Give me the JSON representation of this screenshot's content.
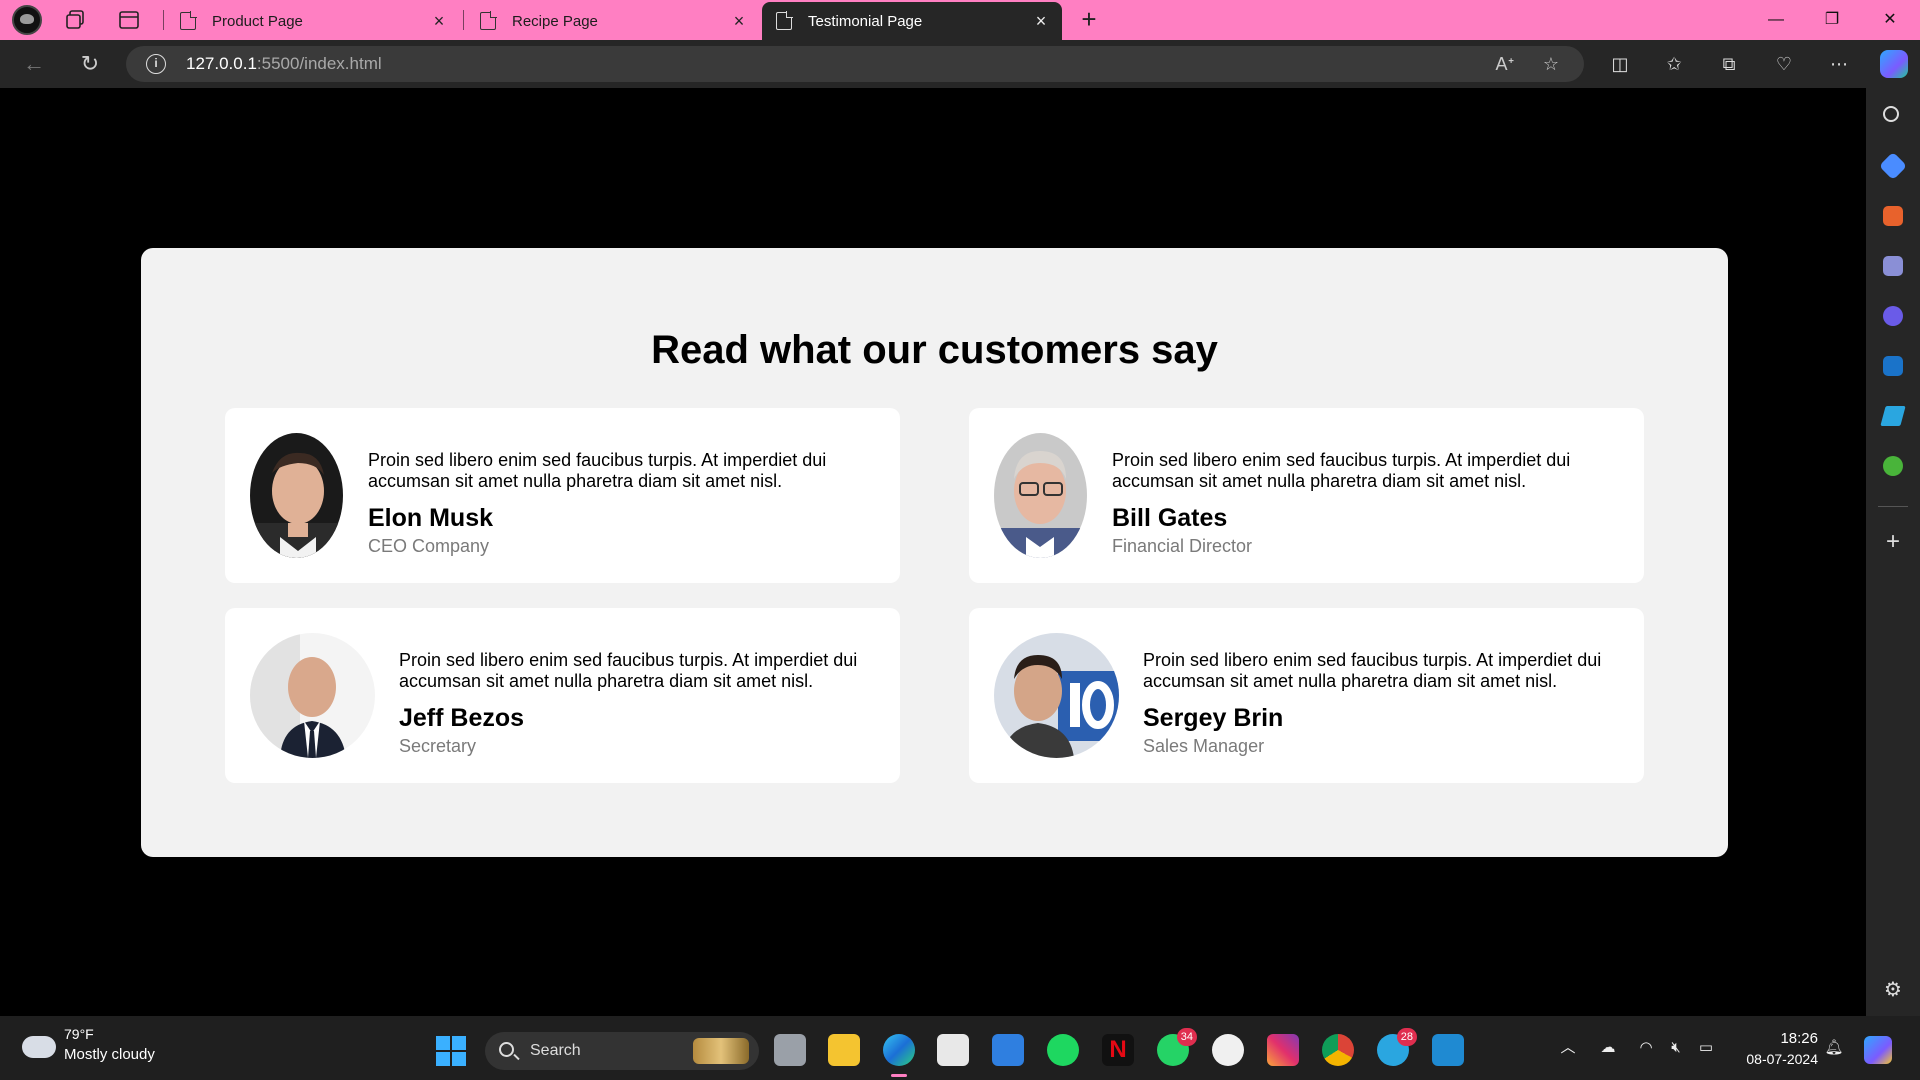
{
  "browser": {
    "tabs": [
      {
        "label": "Product Page",
        "active": false
      },
      {
        "label": "Recipe Page",
        "active": false
      },
      {
        "label": "Testimonial Page",
        "active": true
      }
    ],
    "url_host": "127.0.0.1",
    "url_path": ":5500/index.html"
  },
  "page": {
    "heading": "Read what our customers say",
    "testimonials": [
      {
        "quote": "Proin sed libero enim sed faucibus turpis. At imperdiet dui accumsan sit amet nulla pharetra diam sit amet nisl.",
        "name": "Elon Musk",
        "role": "CEO Company"
      },
      {
        "quote": "Proin sed libero enim sed faucibus turpis. At imperdiet dui accumsan sit amet nulla pharetra diam sit amet nisl.",
        "name": "Bill Gates",
        "role": "Financial Director"
      },
      {
        "quote": "Proin sed libero enim sed faucibus turpis. At imperdiet dui accumsan sit amet nulla pharetra diam sit amet nisl.",
        "name": "Jeff Bezos",
        "role": "Secretary"
      },
      {
        "quote": "Proin sed libero enim sed faucibus turpis. At imperdiet dui accumsan sit amet nulla pharetra diam sit amet nisl.",
        "name": "Sergey Brin",
        "role": "Sales Manager"
      }
    ]
  },
  "taskbar": {
    "weather_temp": "79°F",
    "weather_condition": "Mostly cloudy",
    "search_label": "Search",
    "whatsapp_badge": "34",
    "telegram_badge": "28",
    "time": "18:26",
    "date": "08-07-2024"
  },
  "colors": {
    "tab_bar": "#ff7fc2",
    "browser_chrome": "#262626",
    "page_background": "#000000",
    "container": "#f2f2f2",
    "card": "#ffffff",
    "role_text": "#7a7a7a"
  }
}
